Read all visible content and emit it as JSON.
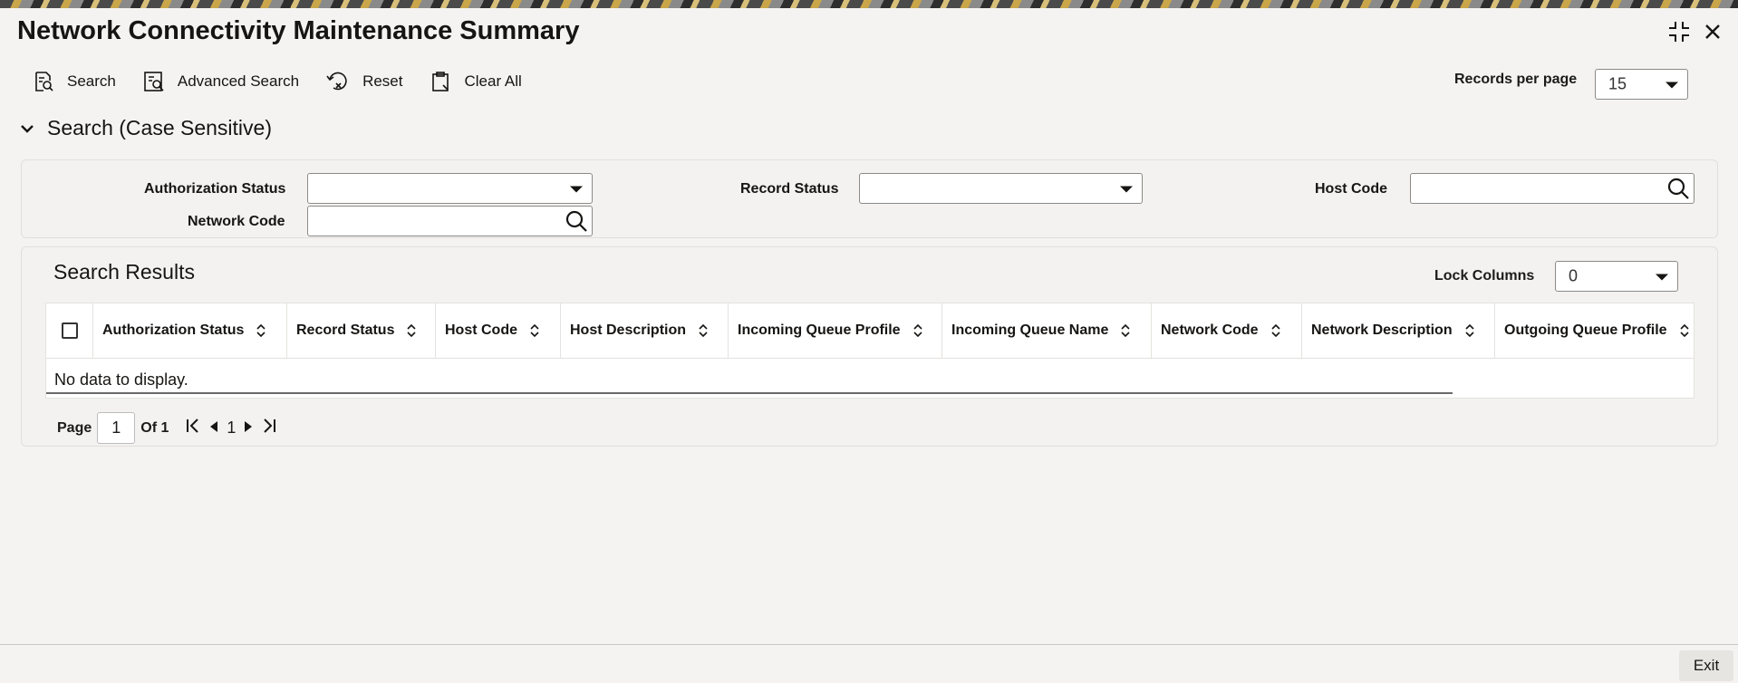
{
  "window": {
    "title": "Network Connectivity Maintenance Summary"
  },
  "toolbar": {
    "search_label": "Search",
    "advanced_search_label": "Advanced Search",
    "reset_label": "Reset",
    "clear_all_label": "Clear All",
    "records_per_page_label": "Records per page",
    "records_per_page_value": "15"
  },
  "search_section": {
    "title": "Search (Case Sensitive)",
    "fields": {
      "authorization_status_label": "Authorization Status",
      "authorization_status_value": "",
      "record_status_label": "Record Status",
      "record_status_value": "",
      "host_code_label": "Host Code",
      "host_code_value": "",
      "network_code_label": "Network Code",
      "network_code_value": ""
    }
  },
  "results": {
    "title": "Search Results",
    "lock_columns_label": "Lock Columns",
    "lock_columns_value": "0",
    "columns": [
      "Authorization Status",
      "Record Status",
      "Host Code",
      "Host Description",
      "Incoming Queue Profile",
      "Incoming Queue Name",
      "Network Code",
      "Network Description",
      "Outgoing Queue Profile"
    ],
    "empty_message": "No data to display."
  },
  "pagination": {
    "page_label": "Page",
    "current_page": "1",
    "of_label": "Of 1",
    "page_link": "1"
  },
  "footer": {
    "exit_label": "Exit"
  }
}
